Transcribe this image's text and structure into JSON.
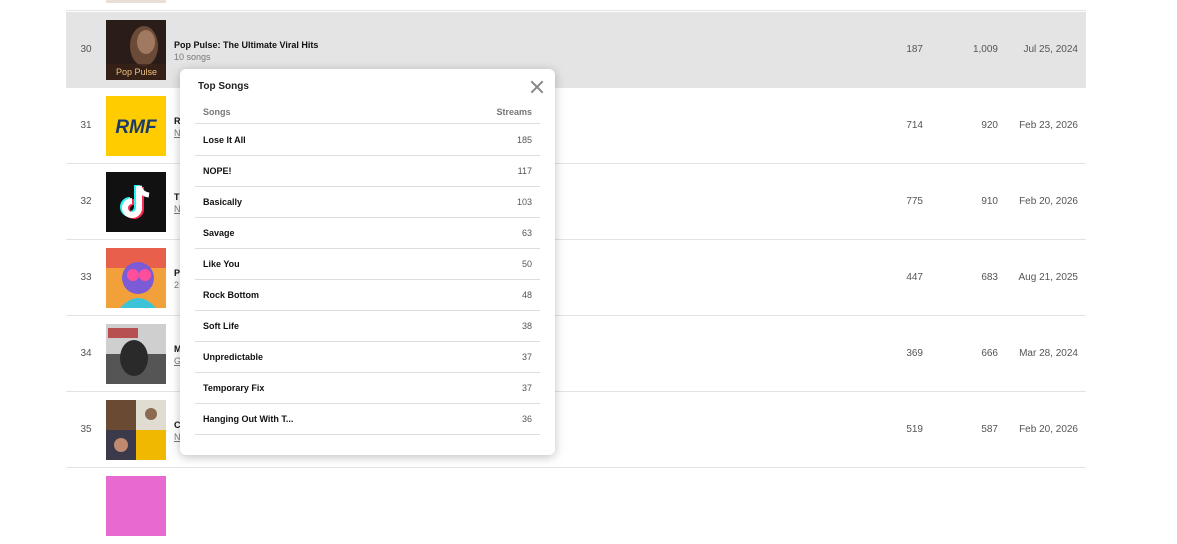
{
  "rows": [
    {
      "rank": "30",
      "title": "Pop Pulse: The Ultimate Viral Hits",
      "sub": "10 songs",
      "c1": "187",
      "c2": "1,009",
      "date": "Jul 25, 2024",
      "thumb_text": "Pop Pulse"
    },
    {
      "rank": "31",
      "title": "RI",
      "sub": "N",
      "c1": "714",
      "c2": "920",
      "date": "Feb 23, 2026",
      "thumb_text": "RMF"
    },
    {
      "rank": "32",
      "title": "Ti",
      "sub": "N",
      "c1": "775",
      "c2": "910",
      "date": "Feb 20, 2026",
      "thumb_text": ""
    },
    {
      "rank": "33",
      "title": "Po",
      "sub": "2",
      "c1": "447",
      "c2": "683",
      "date": "Aug 21, 2025",
      "thumb_text": ""
    },
    {
      "rank": "34",
      "title": "M",
      "sub": "G",
      "c1": "369",
      "c2": "666",
      "date": "Mar 28, 2024",
      "thumb_text": ""
    },
    {
      "rank": "35",
      "title": "Cl",
      "sub": "N",
      "c1": "519",
      "c2": "587",
      "date": "Feb 20, 2026",
      "thumb_text": ""
    }
  ],
  "popup": {
    "title": "Top Songs",
    "col_songs": "Songs",
    "col_streams": "Streams",
    "songs": [
      {
        "name": "Lose It All",
        "streams": "185"
      },
      {
        "name": "NOPE!",
        "streams": "117"
      },
      {
        "name": "Basically",
        "streams": "103"
      },
      {
        "name": "Savage",
        "streams": "63"
      },
      {
        "name": "Like You",
        "streams": "50"
      },
      {
        "name": "Rock Bottom",
        "streams": "48"
      },
      {
        "name": "Soft Life",
        "streams": "38"
      },
      {
        "name": "Unpredictable",
        "streams": "37"
      },
      {
        "name": "Temporary Fix",
        "streams": "37"
      },
      {
        "name": "Hanging Out With T...",
        "streams": "36"
      }
    ]
  }
}
